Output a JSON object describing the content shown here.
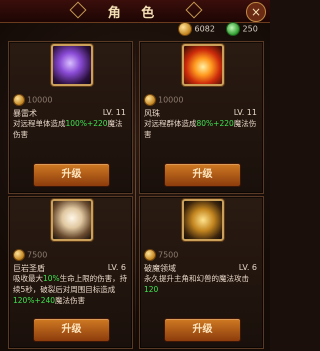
{
  "window": {
    "title": "角 色",
    "close_icon": "close-icon"
  },
  "resources": {
    "gold": "6082",
    "gems": "250"
  },
  "skills": [
    {
      "name": "暴雷术",
      "level": "LV. 11",
      "cost": "10000",
      "desc_prefix": "对远程单体造成",
      "desc_hl": "100%+220",
      "desc_suffix": "魔法伤害",
      "button": "升级",
      "icon": "thunder-icon"
    },
    {
      "name": "风珠",
      "level": "LV. 11",
      "cost": "10000",
      "desc_prefix": "对远程群体造成",
      "desc_hl": "80%+220",
      "desc_suffix": "魔法伤害",
      "button": "升级",
      "icon": "fire-icon"
    },
    {
      "name": "巨岩圣盾",
      "level": "LV. 6",
      "cost": "7500",
      "desc_prefix": "吸收最大",
      "desc_hl": "10%",
      "desc_mid": "生命上限的伤害，持续5秒，破裂后对周围目标造成",
      "desc_hl2": "120%+240",
      "desc_suffix": "魔法伤害",
      "button": "升级",
      "icon": "rock-shield-icon"
    },
    {
      "name": "破魔领域",
      "level": "LV. 6",
      "cost": "7500",
      "desc_prefix": "永久提升主角和幻兽的魔法攻击",
      "desc_hl": "120",
      "desc_suffix": "",
      "button": "升级",
      "icon": "magic-field-icon"
    }
  ]
}
